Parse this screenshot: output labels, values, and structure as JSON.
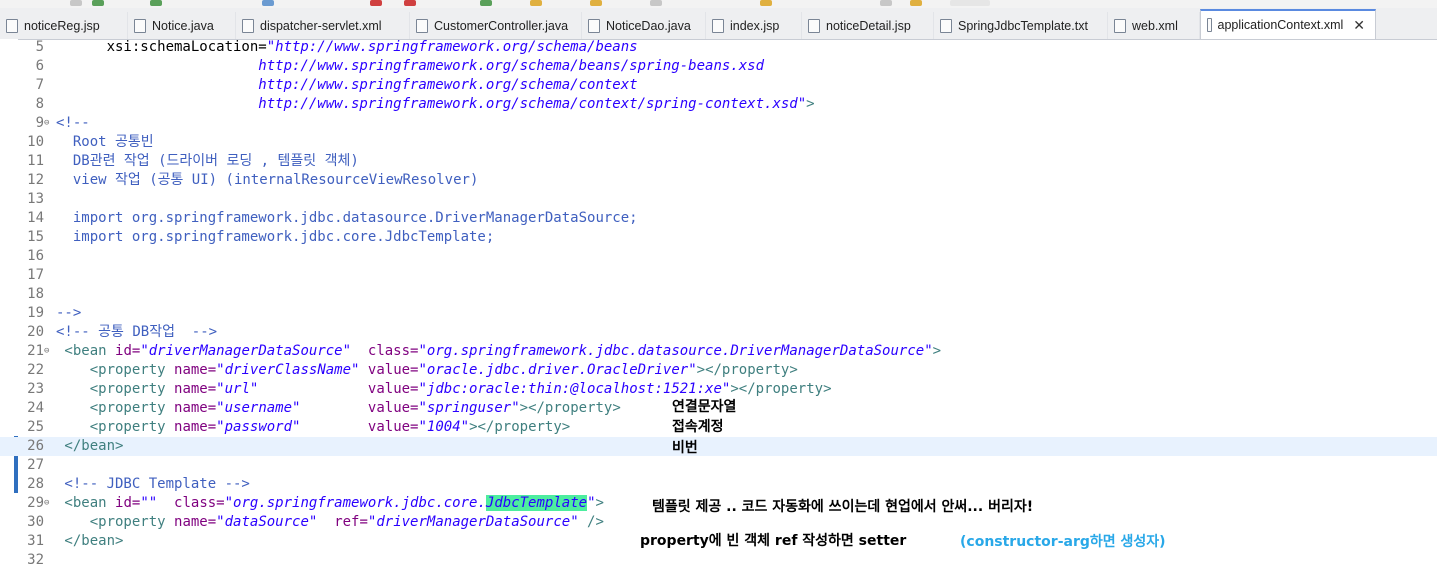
{
  "tabs": [
    {
      "label": "noticeReg.jsp",
      "icon": "jsp-file-icon"
    },
    {
      "label": "Notice.java",
      "icon": "java-file-icon"
    },
    {
      "label": "dispatcher-servlet.xml",
      "icon": "xml-file-icon"
    },
    {
      "label": "CustomerController.java",
      "icon": "java-file-icon"
    },
    {
      "label": "NoticeDao.java",
      "icon": "java-file-icon"
    },
    {
      "label": "index.jsp",
      "icon": "jsp-file-icon"
    },
    {
      "label": "noticeDetail.jsp",
      "icon": "jsp-file-icon"
    },
    {
      "label": "SpringJdbcTemplate.txt",
      "icon": "text-file-icon"
    },
    {
      "label": "web.xml",
      "icon": "xml-file-icon"
    },
    {
      "label": "applicationContext.xml",
      "icon": "xml-file-icon",
      "active": true,
      "close": "✕"
    }
  ],
  "lines": [
    {
      "n": "5",
      "parts": [
        [
          "",
          "      xsi:schemaLocation="
        ],
        [
          "vl",
          "\"http://www.springframework.org/schema/beans"
        ]
      ]
    },
    {
      "n": "6",
      "parts": [
        [
          "vl",
          "                        http://www.springframework.org/schema/beans/spring-beans.xsd"
        ]
      ]
    },
    {
      "n": "7",
      "parts": [
        [
          "vl",
          "                        http://www.springframework.org/schema/context"
        ]
      ]
    },
    {
      "n": "8",
      "parts": [
        [
          "vl",
          "                        http://www.springframework.org/schema/context/spring-context.xsd\""
        ],
        [
          "tg",
          ">"
        ]
      ]
    },
    {
      "n": "9",
      "fold": "⊖",
      "parts": [
        [
          "cm",
          "<!--"
        ]
      ]
    },
    {
      "n": "10",
      "parts": [
        [
          "cm",
          "  Root 공통빈"
        ]
      ]
    },
    {
      "n": "11",
      "parts": [
        [
          "cm",
          "  DB관련 작업 (드라이버 로딩 , 템플릿 객체)"
        ]
      ]
    },
    {
      "n": "12",
      "parts": [
        [
          "cm",
          "  view 작업 (공통 UI) (internalResourceViewResolver)"
        ]
      ]
    },
    {
      "n": "13",
      "parts": []
    },
    {
      "n": "14",
      "parts": [
        [
          "cm",
          "  import org.springframework.jdbc.datasource.DriverManagerDataSource;"
        ]
      ]
    },
    {
      "n": "15",
      "parts": [
        [
          "cm",
          "  import org.springframework.jdbc.core.JdbcTemplate;"
        ]
      ]
    },
    {
      "n": "16",
      "parts": []
    },
    {
      "n": "17",
      "parts": []
    },
    {
      "n": "18",
      "parts": []
    },
    {
      "n": "19",
      "parts": [
        [
          "cm",
          "-->"
        ]
      ]
    },
    {
      "n": "20",
      "parts": [
        [
          "cm",
          "<!-- 공통 DB작업  -->"
        ]
      ]
    },
    {
      "n": "21",
      "fold": "⊖",
      "parts": [
        [
          "tg",
          " <bean "
        ],
        [
          "at",
          "id="
        ],
        [
          "vl",
          "\"driverManagerDataSource\""
        ],
        [
          "",
          "  "
        ],
        [
          "at",
          "class="
        ],
        [
          "vl",
          "\"org.springframework.jdbc.datasource.DriverManagerDataSource\""
        ],
        [
          "tg",
          ">"
        ]
      ]
    },
    {
      "n": "22",
      "parts": [
        [
          "tg",
          "    <property "
        ],
        [
          "at",
          "name="
        ],
        [
          "vl",
          "\"driverClassName\""
        ],
        [
          "",
          " "
        ],
        [
          "at",
          "value="
        ],
        [
          "vl",
          "\"oracle.jdbc.driver.OracleDriver\""
        ],
        [
          "tg",
          "></property>"
        ]
      ]
    },
    {
      "n": "23",
      "parts": [
        [
          "tg",
          "    <property "
        ],
        [
          "at",
          "name="
        ],
        [
          "vl",
          "\"url\""
        ],
        [
          "",
          "             "
        ],
        [
          "at",
          "value="
        ],
        [
          "vl",
          "\"jdbc:oracle:thin:@localhost:1521:xe\""
        ],
        [
          "tg",
          "></property>"
        ]
      ]
    },
    {
      "n": "24",
      "parts": [
        [
          "tg",
          "    <property "
        ],
        [
          "at",
          "name="
        ],
        [
          "vl",
          "\"username\""
        ],
        [
          "",
          "        "
        ],
        [
          "at",
          "value="
        ],
        [
          "vl",
          "\"springuser\""
        ],
        [
          "tg",
          "></property>"
        ]
      ]
    },
    {
      "n": "25",
      "parts": [
        [
          "tg",
          "    <property "
        ],
        [
          "at",
          "name="
        ],
        [
          "vl",
          "\"password\""
        ],
        [
          "",
          "        "
        ],
        [
          "at",
          "value="
        ],
        [
          "vl",
          "\"1004\""
        ],
        [
          "tg",
          "></property>"
        ]
      ]
    },
    {
      "n": "26",
      "current": true,
      "parts": [
        [
          "tg",
          " </bean>"
        ]
      ]
    },
    {
      "n": "27",
      "parts": []
    },
    {
      "n": "28",
      "parts": [
        [
          "cm",
          " <!-- JDBC Template -->"
        ]
      ]
    },
    {
      "n": "29",
      "fold": "⊖",
      "parts": [
        [
          "tg",
          " <bean "
        ],
        [
          "at",
          "id="
        ],
        [
          "vl",
          "\"\""
        ],
        [
          "",
          "  "
        ],
        [
          "at",
          "class="
        ],
        [
          "vl",
          "\"org.springframework.jdbc.core."
        ],
        [
          "vl hl",
          "JdbcTemplate"
        ],
        [
          "vl",
          "\""
        ],
        [
          "tg",
          ">"
        ]
      ]
    },
    {
      "n": "30",
      "parts": [
        [
          "tg",
          "    <property "
        ],
        [
          "at",
          "name="
        ],
        [
          "vl",
          "\"dataSource\""
        ],
        [
          "",
          "  "
        ],
        [
          "at",
          "ref="
        ],
        [
          "vl",
          "\"driverManagerDataSource\""
        ],
        [
          "tg",
          " />"
        ]
      ]
    },
    {
      "n": "31",
      "parts": [
        [
          "tg",
          " </bean>"
        ]
      ]
    },
    {
      "n": "32",
      "parts": []
    }
  ],
  "notes": [
    {
      "text": "연결문자열",
      "style": ""
    },
    {
      "text": "접속계정",
      "style": ""
    },
    {
      "text": "비번",
      "style": ""
    },
    {
      "text": "템플릿 제공 .. 코드 자동화에 쓰이는데 현업에서 안써... 버리자!",
      "style": ""
    },
    {
      "text": "property에 빈 객체 ref 작성하면 setter",
      "style": ""
    },
    {
      "text": "(constructor-arg하면 생성자)",
      "style": "blue"
    }
  ],
  "colors": {
    "tag": "#3f7f7f",
    "attr": "#7f007f",
    "value": "#2a00ff",
    "comment": "#3f5fbf",
    "highlight": "#4ded9f",
    "note_blue": "#29a8e8"
  }
}
